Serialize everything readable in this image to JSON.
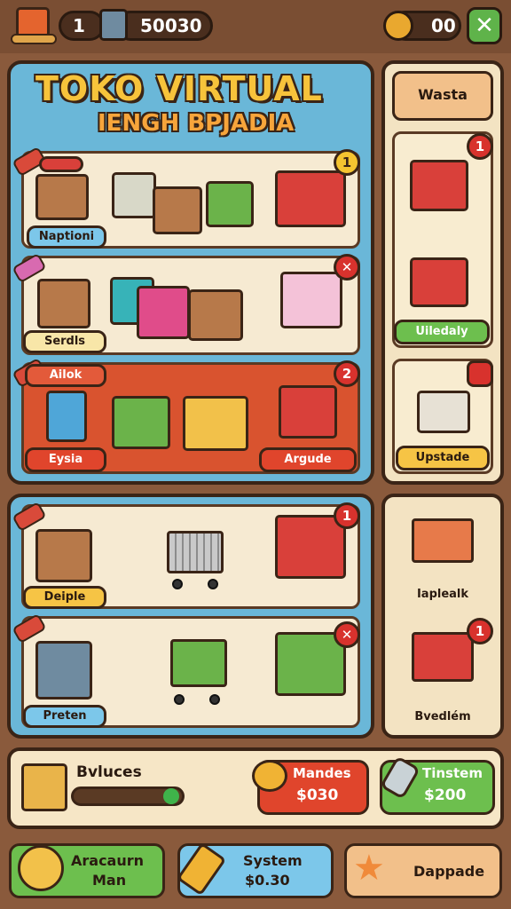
{
  "topbar": {
    "level": "1",
    "coins": "50030",
    "gems": "00",
    "close_symbol": "✕"
  },
  "store": {
    "title": "TOKO VIRTUAL",
    "subtitle": "IENGH BPJADIA"
  },
  "shelves": [
    {
      "label": "Naptioni",
      "badge": "1"
    },
    {
      "label": "Serdls",
      "badge": "✕"
    },
    {
      "header": "Ailok",
      "label_left": "Eysia",
      "label_right": "Argudе",
      "badge": "2"
    }
  ],
  "side_panel": {
    "button": "Wasta",
    "item1_badge": "1",
    "item1_label": "Uiledaly",
    "item2_label": "Upstade"
  },
  "lower_shelves": [
    {
      "label": "Deiple",
      "badge": "1"
    },
    {
      "label": "Preten",
      "badge": "✕"
    }
  ],
  "lower_side": {
    "item1_label": "Iaplealk",
    "item2_label": "Bvedlém",
    "item2_badge": "1"
  },
  "info_bar": {
    "title": "Bvluces",
    "offer1_line1": "Mandes",
    "offer1_line2": "$030",
    "offer2_line1": "Tinstem",
    "offer2_line2": "$200"
  },
  "bottom_nav": [
    {
      "line1": "Aracaurn",
      "line2": "Man"
    },
    {
      "line1": "System",
      "line2": "$0.30"
    },
    {
      "line1": "Dappade",
      "line2": ""
    }
  ]
}
